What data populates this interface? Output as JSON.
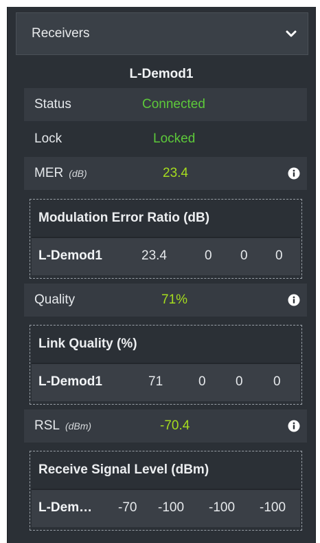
{
  "header": {
    "title": "Receivers",
    "chevron_icon": "chevron-down-icon"
  },
  "receiver": {
    "name": "L-Demod1"
  },
  "status": {
    "label": "Status",
    "value": "Connected",
    "color": "#5dc93a"
  },
  "lock": {
    "label": "Lock",
    "value": "Locked",
    "color": "#5dc93a"
  },
  "mer": {
    "label": "MER",
    "unit": "(dB)",
    "value": "23.4",
    "color": "#a6dd1e",
    "info_icon": "info-icon",
    "detail": {
      "title": "Modulation Error Ratio (dB)",
      "row": {
        "name": "L-Demod1",
        "values": [
          "23.4",
          "0",
          "0",
          "0"
        ]
      }
    }
  },
  "quality": {
    "label": "Quality",
    "value": "71%",
    "color": "#a6dd1e",
    "info_icon": "info-icon",
    "detail": {
      "title": "Link Quality (%)",
      "row": {
        "name": "L-Demod1",
        "values": [
          "71",
          "0",
          "0",
          "0"
        ]
      }
    }
  },
  "rsl": {
    "label": "RSL",
    "unit": "(dBm)",
    "value": "-70.4",
    "color": "#a6dd1e",
    "info_icon": "info-icon",
    "detail": {
      "title": "Receive Signal Level (dBm)",
      "row": {
        "name": "L-Dem…",
        "values": [
          "-70",
          "-100",
          "-100",
          "-100"
        ]
      }
    }
  }
}
